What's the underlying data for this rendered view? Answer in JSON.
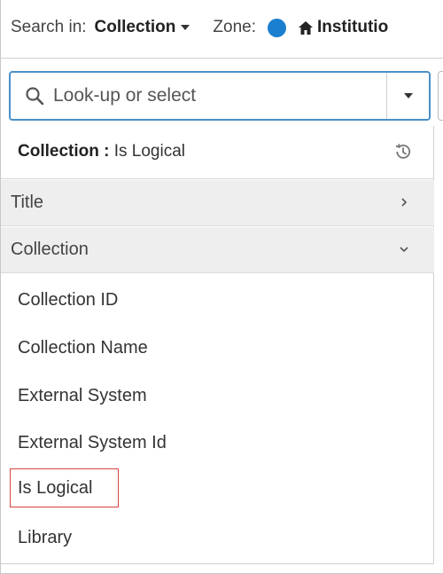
{
  "scope_bar": {
    "search_in_label": "Search in:",
    "search_in_value": "Collection",
    "zone_label": "Zone:",
    "zone_value": "Institutio",
    "zone_color": "#1b7fd0",
    "zone_icon": "home-icon"
  },
  "search": {
    "placeholder": "Look-up or select",
    "value": "",
    "icon": "search-icon"
  },
  "dropdown": {
    "selected": {
      "field": "Collection",
      "separator": " : ",
      "value": "Is Logical",
      "icon": "history-icon"
    },
    "groups": [
      {
        "label": "Title",
        "state": "collapsed",
        "icon": "chevron-right-icon"
      },
      {
        "label": "Collection",
        "state": "expanded",
        "icon": "chevron-down-icon"
      }
    ],
    "items": [
      {
        "label": "Collection ID"
      },
      {
        "label": "Collection Name"
      },
      {
        "label": "External System"
      },
      {
        "label": "External System Id"
      },
      {
        "label": "Is Logical",
        "highlighted": true
      },
      {
        "label": "Library"
      }
    ],
    "highlight_color": "#d9443b",
    "focus_color": "#4a90c8"
  }
}
